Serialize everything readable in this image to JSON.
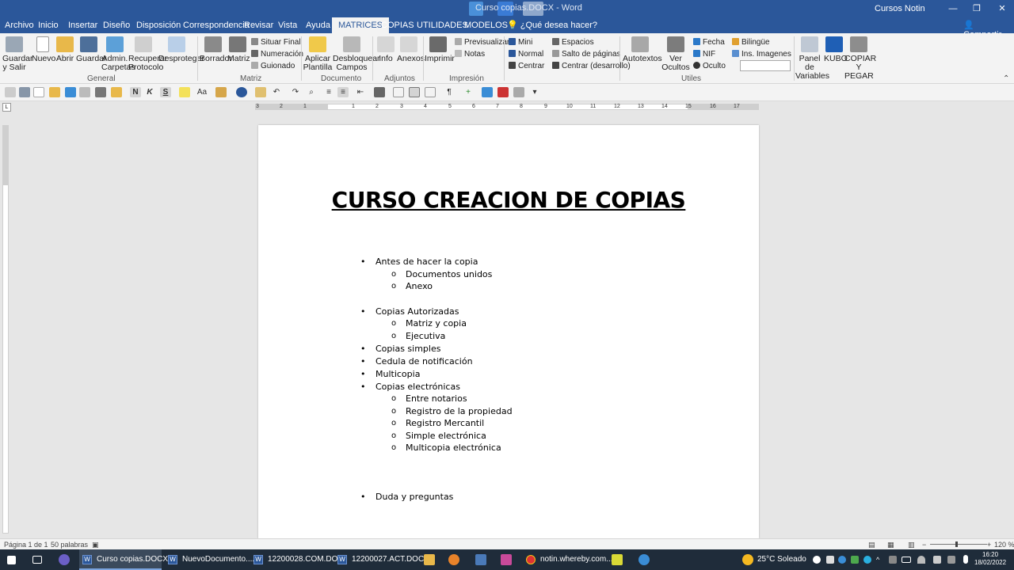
{
  "window": {
    "title": "Curso copias.DOCX - Word",
    "user": "Cursos Notin",
    "minimize": "—",
    "restore": "❐",
    "close": "✕"
  },
  "tabs": [
    "Archivo",
    "Inicio",
    "Insertar",
    "Diseño",
    "Disposición",
    "Correspondencia",
    "Revisar",
    "Vista",
    "Ayuda",
    "MATRICES",
    "COPIAS",
    "UTILIDADES",
    "MODELOS"
  ],
  "active_tab": "MATRICES",
  "tell_me": "¿Qué desea hacer?",
  "share": "Compartir",
  "ribbon": {
    "general": {
      "label": "General",
      "guardar_salir": "Guardar y Salir",
      "nuevo": "Nuevo",
      "abrir": "Abrir",
      "guardar": "Guardar",
      "admin_carpetas": "Admin. Carpetas",
      "recuperar_protocolo": "Recuperar Protocolo",
      "desproteger": "Desproteger"
    },
    "matriz": {
      "label": "Matriz",
      "borrador": "Borrador",
      "matriz": "Matriz",
      "situar_final": "Situar Final",
      "numeracion": "Numeración",
      "guionado": "Guionado"
    },
    "documento": {
      "label": "Documento",
      "aplicar_plantilla": "Aplicar Plantilla",
      "desbloquear_campos": "Desbloquear Campos"
    },
    "adjuntos": {
      "label": "Adjuntos",
      "info": "Info",
      "anexos": "Anexos"
    },
    "impresion": {
      "label": "Impresión",
      "imprimir": "Imprimir",
      "previsualizar": "Previsualizar",
      "notas": "Notas"
    },
    "formato": {
      "mini": "Mini",
      "normal": "Normal",
      "centrar": "Centrar",
      "espacios": "Espacios",
      "salto_paginas": "Salto de páginas",
      "centrar_desarrollo": "Centrar (desarrollo)"
    },
    "utiles": {
      "label": "Utiles",
      "autotextos": "Autotextos",
      "ver_ocultos": "Ver Ocultos",
      "fecha": "Fecha",
      "nif": "NIF",
      "oculto": "Oculto",
      "bilingue": "Bilingüe",
      "ins_imagenes": "Ins. Imagenes"
    },
    "extra": {
      "panel_variables": "Panel de Variables",
      "kubo": "KUBO",
      "copiar_pegar": "COPIAR Y PEGAR"
    }
  },
  "quickbar": {
    "bold": "N",
    "italic": "K",
    "strike": "S",
    "case": "Aa"
  },
  "ruler_ticks": [
    "3",
    "2",
    "1",
    "1",
    "2",
    "3",
    "4",
    "5",
    "6",
    "7",
    "8",
    "9",
    "10",
    "11",
    "12",
    "13",
    "14",
    "15",
    "16",
    "17"
  ],
  "document": {
    "title": "CURSO CREACION DE COPIAS",
    "lines": [
      {
        "level": 1,
        "text": "Antes de hacer la copia"
      },
      {
        "level": 2,
        "text": "Documentos unidos"
      },
      {
        "level": 2,
        "text": "Anexo"
      },
      {
        "level": 1,
        "text": "Copias Autorizadas"
      },
      {
        "level": 2,
        "text": "Matriz y copia"
      },
      {
        "level": 2,
        "text": "Ejecutiva"
      },
      {
        "level": 1,
        "text": "Copias simples"
      },
      {
        "level": 1,
        "text": "Cedula de notificación"
      },
      {
        "level": 1,
        "text": "Multicopia"
      },
      {
        "level": 1,
        "text": "Copias electrónicas"
      },
      {
        "level": 2,
        "text": "Entre notarios"
      },
      {
        "level": 2,
        "text": "Registro de la propiedad"
      },
      {
        "level": 2,
        "text": "Registro Mercantil"
      },
      {
        "level": 2,
        "text": "Simple electrónica"
      },
      {
        "level": 2,
        "text": "Multicopia electrónica"
      },
      {
        "level": 1,
        "text": "Duda y preguntas"
      }
    ],
    "bullet_l1": "•",
    "bullet_l2": "o"
  },
  "statusbar": {
    "page": "Página 1 de 1",
    "words": "50 palabras",
    "zoom": "120 %"
  },
  "taskbar": {
    "apps": [
      "Curso copias.DOCX...",
      "NuevoDocumento....",
      "12200028.COM.DO...",
      "12200027.ACT.DOC...",
      "notin.whereby.com..."
    ],
    "weather": "25°C  Soleado",
    "time": "16:20",
    "date": "18/02/2022"
  },
  "colors": {
    "word_blue": "#2b579a",
    "ribbon_bg": "#f3f3f3",
    "taskbar_bg": "#1f2c3a"
  }
}
